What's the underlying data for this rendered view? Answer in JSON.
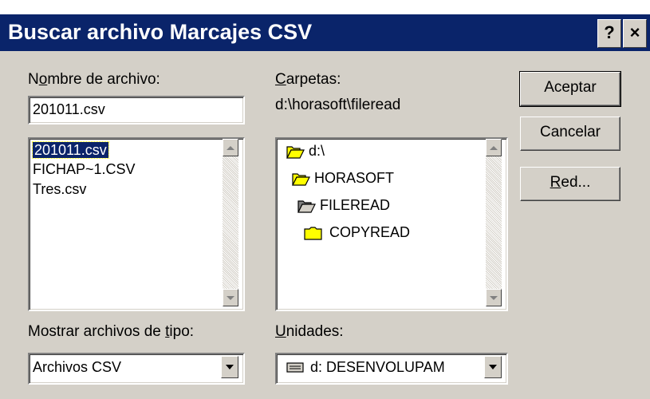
{
  "window": {
    "title": "Buscar archivo Marcajes CSV",
    "help_label": "?",
    "close_label": "×"
  },
  "filename": {
    "label_pre": "N",
    "label_u": "o",
    "label_post": "mbre de archivo:",
    "value": "201011.csv"
  },
  "files": [
    "201011.csv",
    "FICHAP~1.CSV",
    "Tres.csv"
  ],
  "selected_file": "201011.csv",
  "folders": {
    "label_u": "C",
    "label_post": "arpetas:",
    "path": "d:\\horasoft\\fileread",
    "items": [
      {
        "name": "d:\\",
        "icon": "open-folder-icon"
      },
      {
        "name": "HORASOFT",
        "icon": "open-folder-icon"
      },
      {
        "name": "FILEREAD",
        "icon": "open-folder-icon"
      },
      {
        "name": "COPYREAD",
        "icon": "folder-icon"
      }
    ]
  },
  "filetype": {
    "label_pre": "Mostrar archivos de ",
    "label_u": "t",
    "label_post": "ipo:",
    "value": "Archivos CSV"
  },
  "drives": {
    "label_u": "U",
    "label_post": "nidades:",
    "value": "d: DESENVOLUPAM",
    "icon": "drive-icon"
  },
  "buttons": {
    "accept": "Aceptar",
    "cancel": "Cancelar",
    "network_u": "R",
    "network_post": "ed..."
  },
  "colors": {
    "title_bar": "#0a246a",
    "face": "#d4d0c8",
    "folder": "#ffff00"
  }
}
